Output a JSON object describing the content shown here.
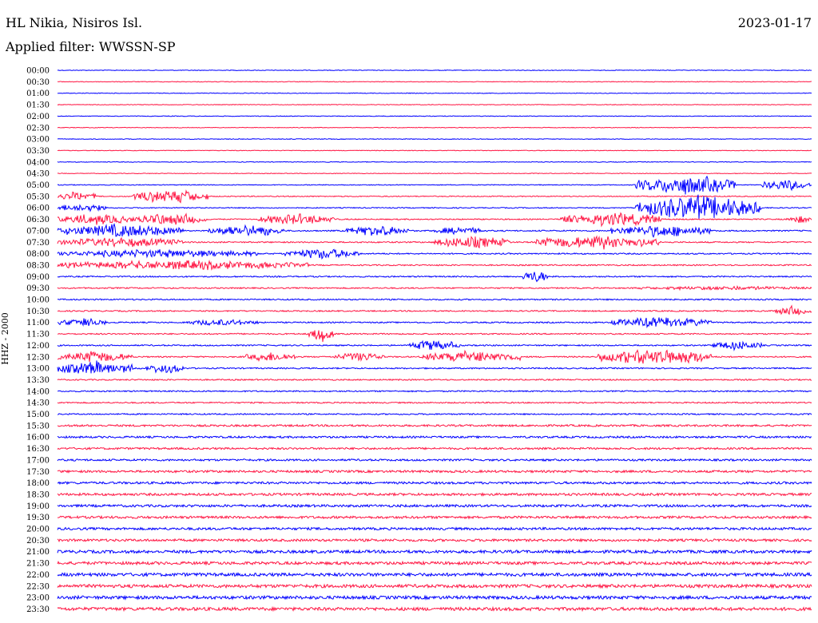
{
  "header": {
    "station": "HL Nikia, Nisiros Isl.",
    "date": "2023-01-17",
    "filter_label": "Applied filter: WWSSN-SP"
  },
  "chart_data": {
    "type": "line",
    "ylabel": "HHZ - 2000",
    "colors": [
      "#0000ff",
      "#ff1744"
    ],
    "rows": [
      "00:00",
      "00:30",
      "01:00",
      "01:30",
      "02:00",
      "02:30",
      "03:00",
      "03:30",
      "04:00",
      "04:30",
      "05:00",
      "05:30",
      "06:00",
      "06:30",
      "07:00",
      "07:30",
      "08:00",
      "08:30",
      "09:00",
      "09:30",
      "10:00",
      "10:30",
      "11:00",
      "11:30",
      "12:00",
      "12:30",
      "13:00",
      "13:30",
      "14:00",
      "14:30",
      "15:00",
      "15:30",
      "16:00",
      "16:30",
      "17:00",
      "17:30",
      "18:00",
      "18:30",
      "19:00",
      "19:30",
      "20:00",
      "20:30",
      "21:00",
      "21:30",
      "22:00",
      "22:30",
      "23:00",
      "23:30"
    ],
    "minutes_per_row": 30,
    "base_amplitude": [
      0.4,
      0.4,
      0.4,
      0.4,
      0.4,
      0.4,
      0.4,
      0.4,
      0.4,
      0.4,
      0.5,
      0.6,
      0.6,
      0.7,
      0.8,
      0.8,
      0.8,
      0.8,
      0.8,
      0.8,
      0.8,
      0.8,
      0.8,
      0.8,
      0.8,
      0.8,
      0.8,
      0.8,
      0.8,
      0.8,
      0.8,
      1.2,
      1.2,
      1.2,
      1.2,
      1.4,
      1.4,
      1.5,
      1.5,
      1.5,
      1.5,
      1.5,
      1.8,
      1.8,
      2.0,
      2.0,
      2.0,
      2.0
    ],
    "bursts": [
      {
        "row": 10,
        "start": 23.0,
        "end": 27.0,
        "amp": 14
      },
      {
        "row": 10,
        "start": 28.0,
        "end": 30.0,
        "amp": 8
      },
      {
        "row": 11,
        "start": 0.0,
        "end": 1.5,
        "amp": 7
      },
      {
        "row": 11,
        "start": 3.0,
        "end": 6.0,
        "amp": 10
      },
      {
        "row": 12,
        "start": 0.0,
        "end": 2.0,
        "amp": 6
      },
      {
        "row": 12,
        "start": 23.0,
        "end": 28.0,
        "amp": 18
      },
      {
        "row": 13,
        "start": 0.0,
        "end": 3.0,
        "amp": 8
      },
      {
        "row": 13,
        "start": 3.0,
        "end": 6.0,
        "amp": 9
      },
      {
        "row": 13,
        "start": 8.0,
        "end": 11.0,
        "amp": 8
      },
      {
        "row": 13,
        "start": 20.0,
        "end": 24.0,
        "amp": 10
      },
      {
        "row": 13,
        "start": 29.0,
        "end": 30.0,
        "amp": 6
      },
      {
        "row": 14,
        "start": 0.0,
        "end": 5.0,
        "amp": 10
      },
      {
        "row": 14,
        "start": 6.0,
        "end": 9.0,
        "amp": 9
      },
      {
        "row": 14,
        "start": 11.5,
        "end": 14.0,
        "amp": 8
      },
      {
        "row": 14,
        "start": 15.0,
        "end": 17.0,
        "amp": 6
      },
      {
        "row": 14,
        "start": 22.0,
        "end": 26.0,
        "amp": 9
      },
      {
        "row": 15,
        "start": 0.0,
        "end": 5.0,
        "amp": 7
      },
      {
        "row": 15,
        "start": 15.0,
        "end": 18.0,
        "amp": 9
      },
      {
        "row": 15,
        "start": 19.0,
        "end": 24.0,
        "amp": 10
      },
      {
        "row": 16,
        "start": 0.0,
        "end": 8.0,
        "amp": 6
      },
      {
        "row": 16,
        "start": 9.0,
        "end": 12.0,
        "amp": 8
      },
      {
        "row": 17,
        "start": 0.0,
        "end": 10.0,
        "amp": 7
      },
      {
        "row": 18,
        "start": 18.5,
        "end": 19.5,
        "amp": 10
      },
      {
        "row": 19,
        "start": 23.0,
        "end": 30.0,
        "amp": 3
      },
      {
        "row": 21,
        "start": 28.5,
        "end": 30.0,
        "amp": 7
      },
      {
        "row": 22,
        "start": 0.0,
        "end": 2.0,
        "amp": 6
      },
      {
        "row": 22,
        "start": 5.0,
        "end": 8.0,
        "amp": 5
      },
      {
        "row": 22,
        "start": 22.0,
        "end": 26.0,
        "amp": 8
      },
      {
        "row": 23,
        "start": 10.0,
        "end": 11.0,
        "amp": 12
      },
      {
        "row": 24,
        "start": 14.0,
        "end": 16.0,
        "amp": 8
      },
      {
        "row": 24,
        "start": 26.0,
        "end": 28.0,
        "amp": 7
      },
      {
        "row": 25,
        "start": 0.0,
        "end": 3.0,
        "amp": 8
      },
      {
        "row": 25,
        "start": 7.5,
        "end": 9.5,
        "amp": 7
      },
      {
        "row": 25,
        "start": 11.0,
        "end": 13.0,
        "amp": 7
      },
      {
        "row": 25,
        "start": 14.5,
        "end": 18.5,
        "amp": 9
      },
      {
        "row": 25,
        "start": 21.5,
        "end": 26.0,
        "amp": 12
      },
      {
        "row": 26,
        "start": 0.0,
        "end": 3.0,
        "amp": 10
      },
      {
        "row": 26,
        "start": 3.5,
        "end": 5.0,
        "amp": 8
      }
    ],
    "grid": false,
    "legend": "none"
  }
}
